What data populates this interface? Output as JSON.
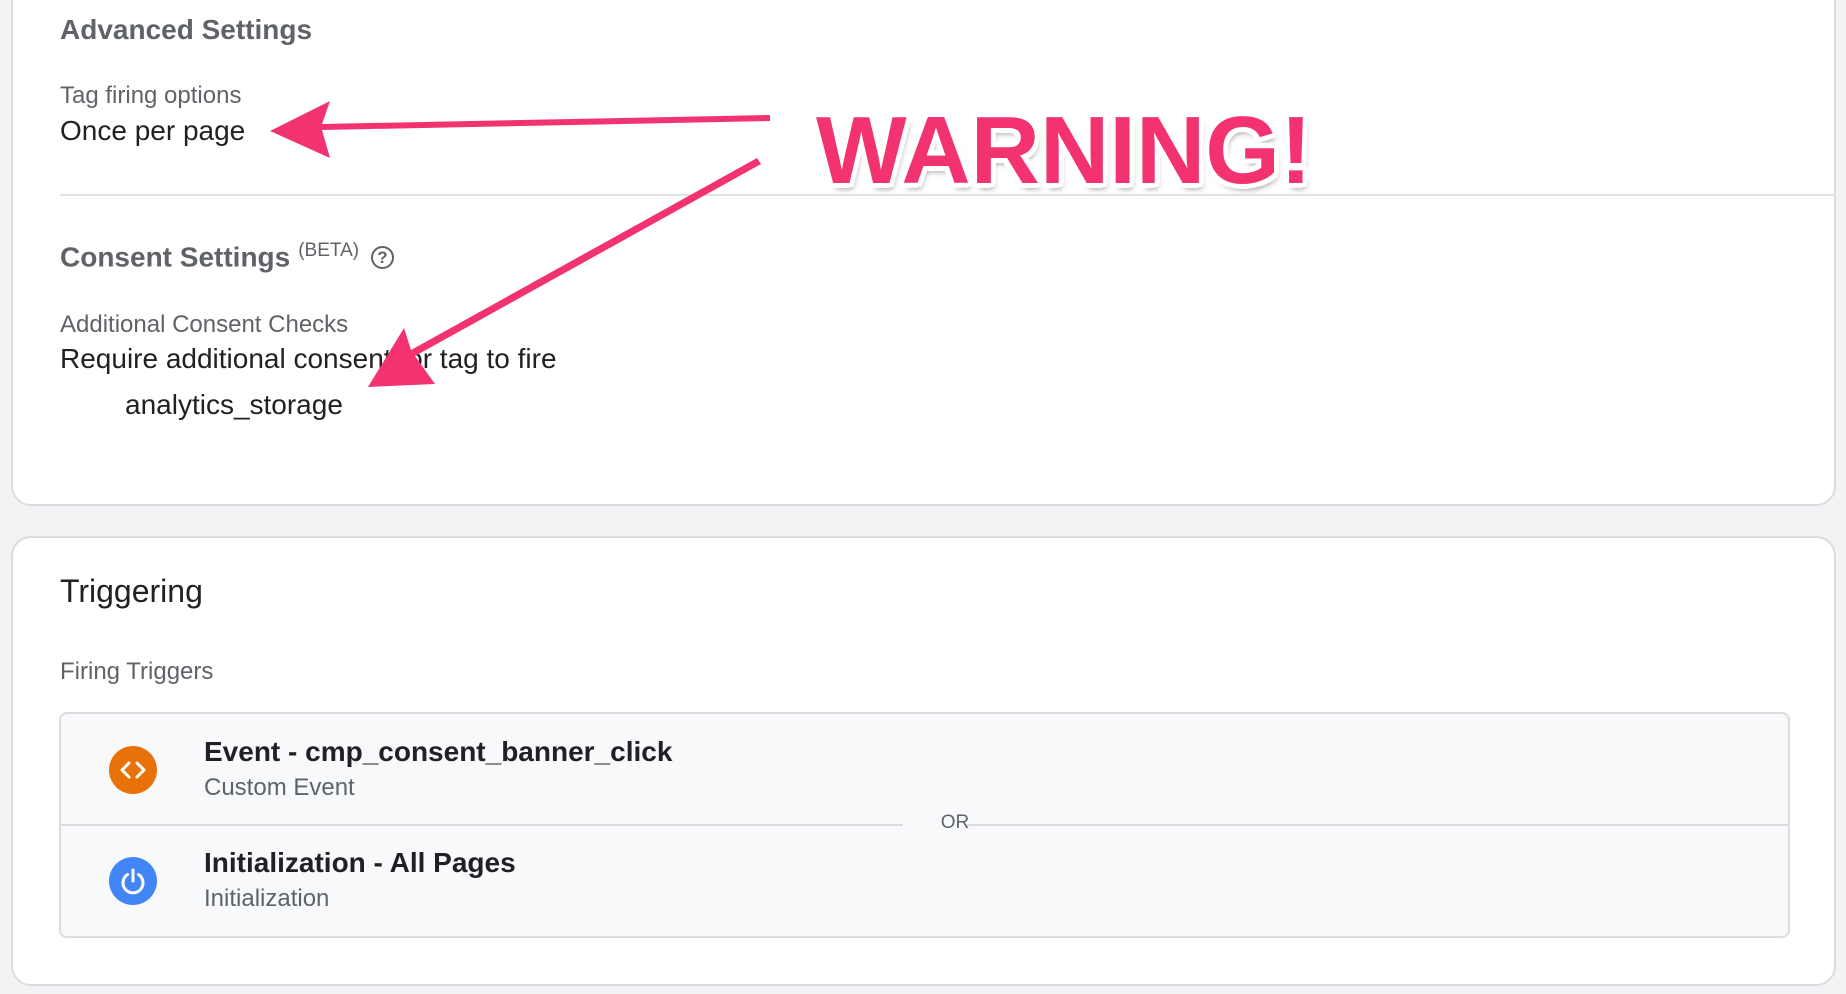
{
  "advanced_settings": {
    "title": "Advanced Settings",
    "tag_firing_label": "Tag firing options",
    "tag_firing_value": "Once per page"
  },
  "consent_settings": {
    "title": "Consent Settings",
    "beta_label": "(BETA)",
    "help_icon": "help-circle-icon",
    "checks_label": "Additional Consent Checks",
    "checks_value": "Require additional consent for tag to fire",
    "consent_type": "analytics_storage"
  },
  "triggering": {
    "title": "Triggering",
    "firing_label": "Firing Triggers",
    "separator": "OR",
    "triggers": [
      {
        "name": "Event - cmp_consent_banner_click",
        "type": "Custom Event",
        "icon": "code-brackets-icon",
        "color": "#e8710a"
      },
      {
        "name": "Initialization - All Pages",
        "type": "Initialization",
        "icon": "power-icon",
        "color": "#4285f4"
      }
    ]
  },
  "annotation": {
    "text": "WARNING!",
    "color": "#f2336f"
  }
}
